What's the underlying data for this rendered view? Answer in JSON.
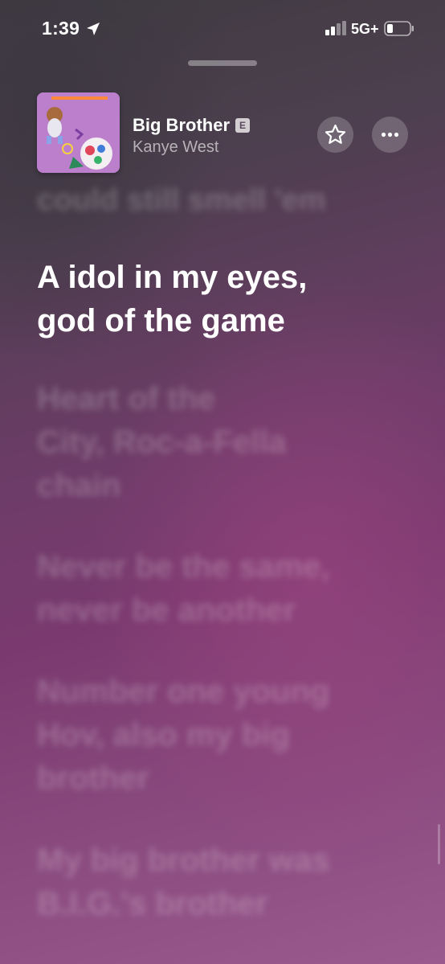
{
  "status_bar": {
    "time": "1:39",
    "network": "5G+"
  },
  "now_playing": {
    "title": "Big Brother",
    "explicit_badge": "E",
    "artist": "Kanye West"
  },
  "lyrics": {
    "previous": "could still smell 'em",
    "current": [
      "A idol in my eyes,",
      "god of the game"
    ],
    "upcoming": [
      [
        "Heart of the",
        "City, Roc-a-Fella",
        "chain"
      ],
      [
        "Never be the same,",
        "never be another"
      ],
      [
        "Number one young",
        "Hov, also my big",
        "brother"
      ],
      [
        "My big brother was",
        "B.I.G.'s brother"
      ]
    ]
  },
  "icons": {
    "location": "location-arrow-icon",
    "favorite": "star-icon",
    "more": "ellipsis-icon"
  }
}
